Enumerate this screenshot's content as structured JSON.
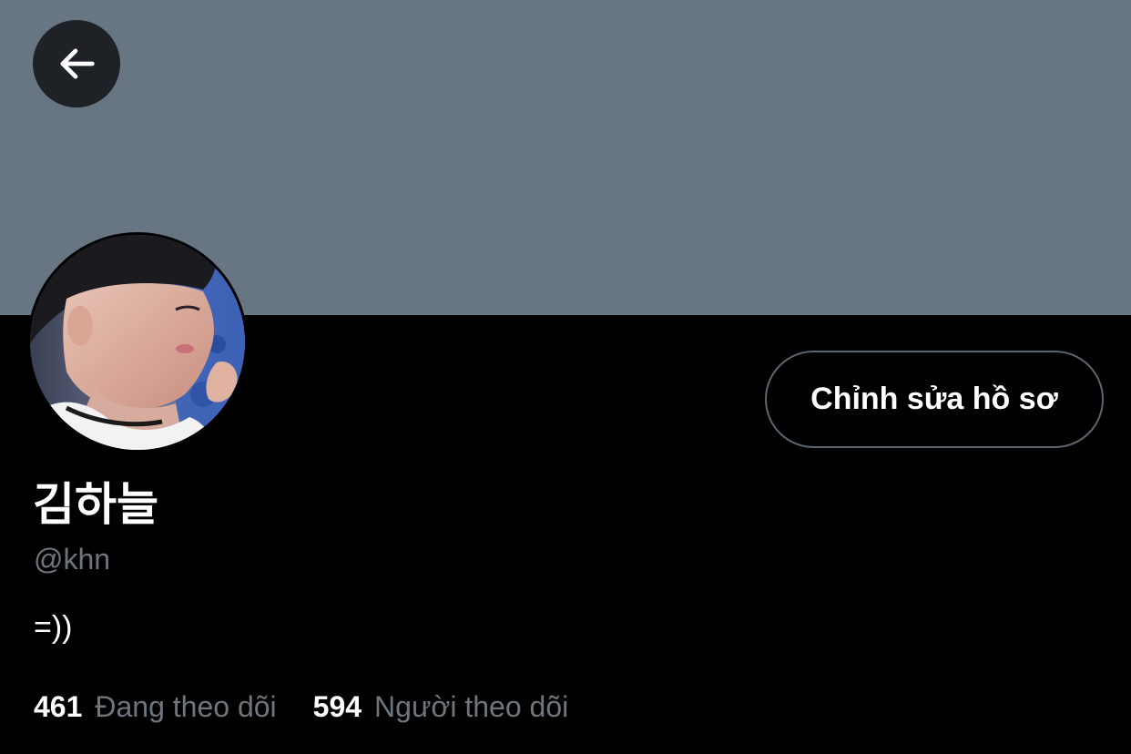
{
  "colors": {
    "banner": "#687684",
    "background": "#000000",
    "text_primary": "#ffffff",
    "text_secondary": "#6e767d",
    "button_border": "#5b6670",
    "back_button_bg": "#1e2227"
  },
  "header": {
    "back_icon": "arrow-left-icon"
  },
  "profile": {
    "avatar_icon": "profile-photo",
    "edit_label": "Chỉnh sửa hồ sơ",
    "display_name": "김하늘",
    "handle": "@khn",
    "bio": "=))"
  },
  "stats": {
    "following_count": "461",
    "following_label": "Đang theo dõi",
    "followers_count": "594",
    "followers_label": "Người theo dõi"
  }
}
